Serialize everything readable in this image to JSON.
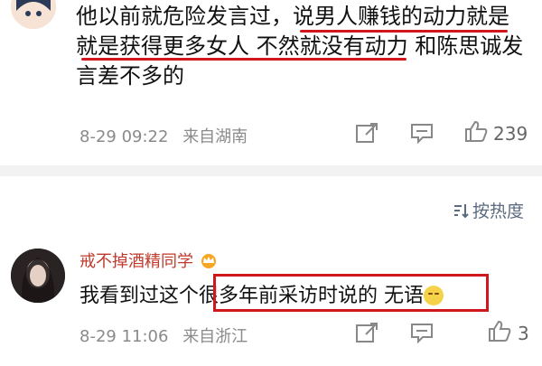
{
  "comment1": {
    "lines": [
      "他以前就危险发言过，说男人赚钱的动力就是",
      "就是获得更多女人 不然就没有动力 和陈思诚发",
      "言差不多的"
    ],
    "time": "8-29 09:22",
    "location": "来自湖南",
    "likes": "239",
    "icons": [
      "share-icon",
      "comment-icon",
      "like-icon"
    ]
  },
  "sort_label": "按热度",
  "comment2": {
    "username": "戒不掉酒精同学",
    "text_before": "我看到过这个",
    "text_highlight": "很多年前采访时说的 无语",
    "time": "8-29 11:06",
    "location": "来自浙江",
    "likes": "3"
  },
  "colors": {
    "accent_red": "#d0171e",
    "meta_gray": "#8a8a8a",
    "username_red": "#c0392b"
  }
}
